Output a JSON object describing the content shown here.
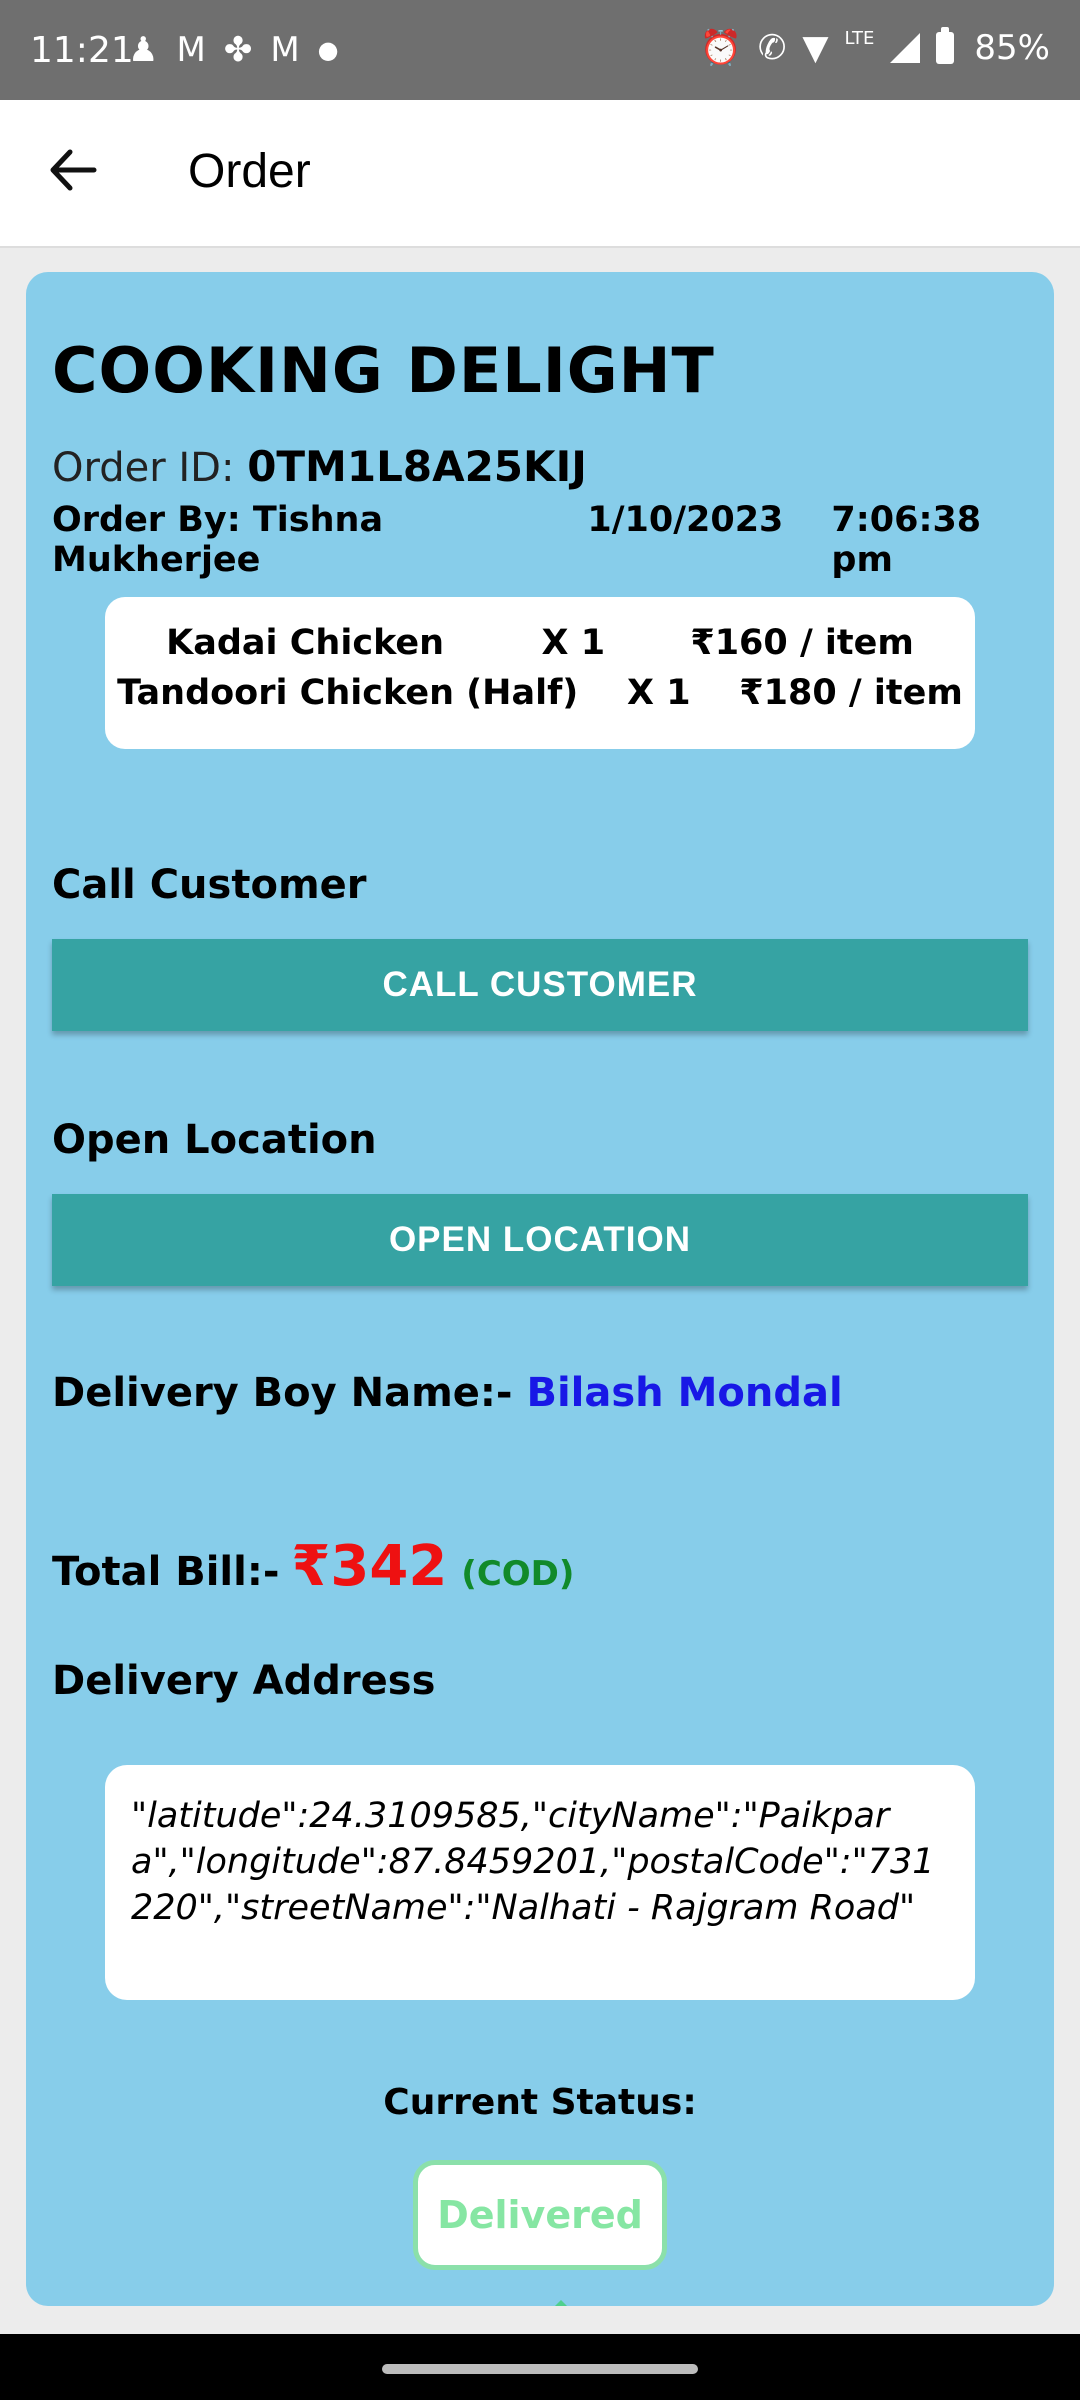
{
  "status_bar": {
    "time": "11:21",
    "left_icons": [
      "notification-person-icon",
      "gmail-icon",
      "fan-icon",
      "gmail-icon",
      "dot-icon"
    ],
    "network": "LTE",
    "battery": "85%",
    "background": "#6f6f6f"
  },
  "app_bar": {
    "title": "Order",
    "back_icon": "arrow-left-icon"
  },
  "order": {
    "restaurant": "COOKING DELIGHT",
    "order_id_label": "Order ID:",
    "order_id": "0TM1L8A25KIJ",
    "order_by": "Order By: Tishna Mukherjee",
    "date": "1/10/2023",
    "time": "7:06:38 pm",
    "items": [
      {
        "line": "Kadai Chicken        X 1       ₹160 / item"
      },
      {
        "line": "Tandoori Chicken (Half)    X 1    ₹180 / item"
      }
    ]
  },
  "actions": {
    "call_label": "Call Customer",
    "call_button": "CALL CUSTOMER",
    "location_label": "Open Location",
    "location_button": "OPEN LOCATION"
  },
  "delivery": {
    "label": "Delivery Boy Name:-",
    "name": "Bilash Mondal"
  },
  "bill": {
    "label": "Total Bill:-",
    "amount": "₹342",
    "method": "(COD)"
  },
  "address": {
    "label": "Delivery Address",
    "text": "\"latitude\":24.3109585,\"cityName\":\"Paikpara\",\"longitude\":87.8459201,\"postalCode\":\"731220\",\"streetName\":\"Nalhati - Rajgram Road\""
  },
  "status": {
    "label": "Current Status:",
    "value": "Delivered"
  },
  "colors": {
    "card": "#87cdea",
    "button": "#36a3a3",
    "delivery_boy": "#1818e6",
    "amount": "#ee1111",
    "cod": "#118a2a",
    "status": "#86e6a3"
  }
}
